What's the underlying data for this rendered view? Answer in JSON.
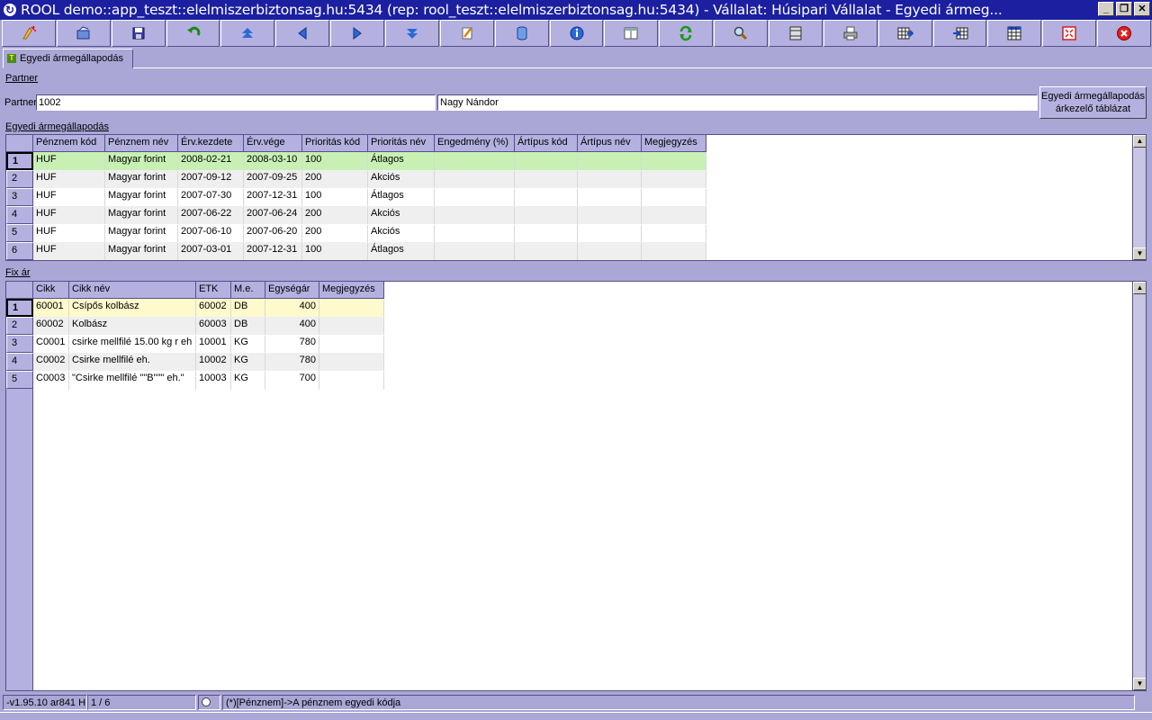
{
  "window": {
    "title": "ROOL demo::app_teszt::elelmiszerbiztonsag.hu:5434 (rep: rool_teszt::elelmiszerbiztonsag.hu:5434) - Vállalat: Húsipari Vállalat - Egyedi ármeg...",
    "minimize": "_",
    "restore": "❐",
    "close": "✕"
  },
  "toolbar": {
    "buttons": [
      "new-icon",
      "open-icon",
      "save-icon",
      "undo-icon",
      "first-icon",
      "prev-icon",
      "next-icon",
      "last-icon",
      "edit-icon",
      "database-icon",
      "info-icon",
      "layout-icon",
      "refresh-icon",
      "search-icon",
      "columns-icon",
      "print-icon",
      "grid-export-icon",
      "grid-import-icon",
      "table-icon",
      "fullscreen-icon",
      "exit-icon"
    ]
  },
  "tabs": [
    {
      "label": "Egyedi ármegállapodás",
      "icon": "T"
    }
  ],
  "partner_section": {
    "title": "Partner",
    "label": "Partner",
    "code": "1002",
    "name": "Nagy Nándor",
    "button_line1": "Egyedi ármegállapodás",
    "button_line2": "árkezelő táblázat"
  },
  "agreements": {
    "title": "Egyedi ármegállapodás",
    "columns": [
      "Pénznem kód",
      "Pénznem név",
      "Érv.kezdete",
      "Érv.vége",
      "Prioritás kód",
      "Prioritás név",
      "Engedmény (%)",
      "Ártípus kód",
      "Ártípus név",
      "Megjegyzés"
    ],
    "rows": [
      {
        "n": "1",
        "c": [
          "HUF",
          "Magyar forint",
          "2008-02-21",
          "2008-03-10",
          "100",
          "Átlagos",
          "",
          "",
          "",
          ""
        ]
      },
      {
        "n": "2",
        "c": [
          "HUF",
          "Magyar forint",
          "2007-09-12",
          "2007-09-25",
          "200",
          "Akciós",
          "",
          "",
          "",
          ""
        ]
      },
      {
        "n": "3",
        "c": [
          "HUF",
          "Magyar forint",
          "2007-07-30",
          "2007-12-31",
          "100",
          "Átlagos",
          "",
          "",
          "",
          ""
        ]
      },
      {
        "n": "4",
        "c": [
          "HUF",
          "Magyar forint",
          "2007-06-22",
          "2007-06-24",
          "200",
          "Akciós",
          "",
          "",
          "",
          ""
        ]
      },
      {
        "n": "5",
        "c": [
          "HUF",
          "Magyar forint",
          "2007-06-10",
          "2007-06-20",
          "200",
          "Akciós",
          "",
          "",
          "",
          ""
        ]
      },
      {
        "n": "6",
        "c": [
          "HUF",
          "Magyar forint",
          "2007-03-01",
          "2007-12-31",
          "100",
          "Átlagos",
          "",
          "",
          "",
          ""
        ]
      }
    ]
  },
  "fixprice": {
    "title": "Fix ár",
    "columns": [
      "Cikk",
      "Cikk név",
      "ETK",
      "M.e.",
      "Egységár",
      "Megjegyzés"
    ],
    "rows": [
      {
        "n": "1",
        "c": [
          "60001",
          "Csípős kolbász",
          "60002",
          "DB",
          "400",
          ""
        ]
      },
      {
        "n": "2",
        "c": [
          "60002",
          "Kolbász",
          "60003",
          "DB",
          "400",
          ""
        ]
      },
      {
        "n": "3",
        "c": [
          "C0001",
          " csirke mellfilé 15.00 kg r eh",
          "10001",
          "KG",
          "780",
          ""
        ]
      },
      {
        "n": "4",
        "c": [
          "C0002",
          "Csirke mellfilé eh.",
          "10002",
          "KG",
          "780",
          ""
        ]
      },
      {
        "n": "5",
        "c": [
          "C0003",
          "\"Csirke mellfilé \"\"B\"\"\" eh.\"",
          "10003",
          "KG",
          "700",
          ""
        ]
      }
    ]
  },
  "statusbar": {
    "version": "-v1.95.10 ar841 H",
    "record": "1 / 6",
    "hint": "(*)[Pénznem]->A pénznem egyedi kódja"
  }
}
